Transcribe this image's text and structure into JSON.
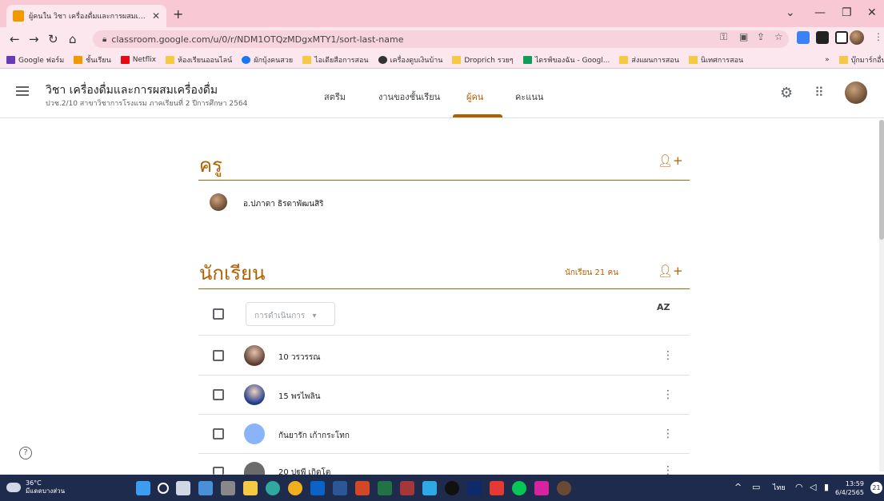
{
  "browser": {
    "tab_title": "ผู้คนใน วิชา เครื่องดื่มและการผสมเครื่องดื่",
    "url": "classroom.google.com/u/0/r/NDM1OTQzMDgxMTY1/sort-last-name",
    "bookmarks": [
      "Google ฟอร์ม",
      "ชั้นเรียน",
      "Netflix",
      "ห้องเรียนออนไลน์",
      "ผักบุ้งคนสวย",
      "ไอเดียสือการสอน",
      "เครื่องดูบเงินบ้าน",
      "Droprich รวยๆ",
      "ไดรฟ์ของฉัน - Googl...",
      "ส่งแผนการสอน",
      "นิเทศการสอน",
      "บุ๊กมาร์กอื่นๆ"
    ],
    "bookmarks_more": "»"
  },
  "header": {
    "course_title": "วิชา เครื่องดื่มและการผสมเครื่องดื่ม",
    "course_subtitle": "ปวช.2/10 สาขาวิชาการโรงแรม ภาคเรียนที่ 2 ปีการศึกษา 2564",
    "tabs": [
      "สตรีม",
      "งานของชั้นเรียน",
      "ผู้คน",
      "คะแนน"
    ],
    "active_tab": "ผู้คน"
  },
  "teachers": {
    "heading": "ครู",
    "list": [
      "อ.ปภาดา ธิรดาพัฒนสิริ"
    ]
  },
  "students": {
    "heading": "นักเรียน",
    "count_label": "นักเรียน 21 คน",
    "actions_placeholder": "การดำเนินการ",
    "sort_label": "AZ",
    "list": [
      "10 วรวรรณ",
      "15 พรไพลิน",
      "กันยารัก เก้ากระโทก",
      "20 ปฐพี เกิดโต"
    ]
  },
  "taskbar": {
    "weather_temp": "36°C",
    "weather_desc": "มีแดดบางส่วน",
    "language": "ไทย",
    "time": "13:59",
    "date": "6/4/2565",
    "notifications": "21"
  },
  "colors": {
    "accent": "#b06000",
    "chrome_pink": "#f8c8d4",
    "taskbar": "#1f2b4d"
  }
}
